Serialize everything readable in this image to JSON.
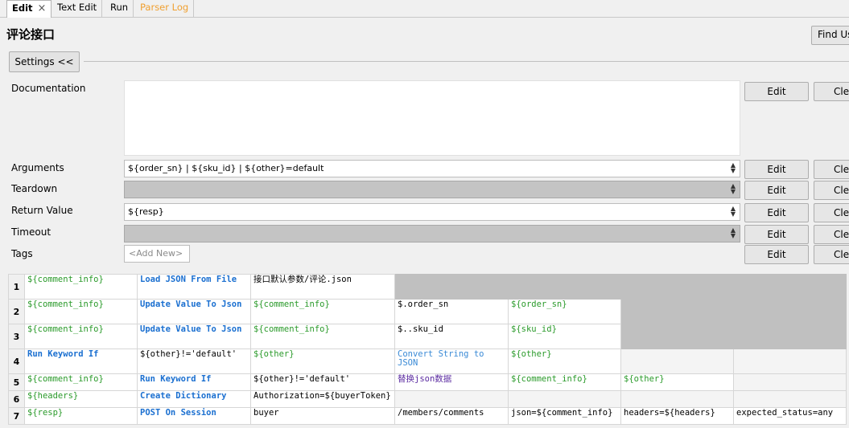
{
  "tabs": [
    {
      "label": "Edit",
      "active": true,
      "close": "×"
    },
    {
      "label": "Text Edit"
    },
    {
      "label": "Run"
    },
    {
      "label": "Parser Log",
      "color": "#f0a030"
    }
  ],
  "title": "评论接口",
  "find_usages": "Find Us",
  "settings_label": "Settings <<",
  "labels": {
    "documentation": "Documentation",
    "arguments": "Arguments",
    "teardown": "Teardown",
    "return_value": "Return Value",
    "timeout": "Timeout",
    "tags": "Tags"
  },
  "fields": {
    "documentation": "",
    "arguments": "${order_sn} | ${sku_id} | ${other}=default",
    "teardown": "",
    "return_value": "${resp}",
    "timeout": "",
    "tags_add": "<Add New>"
  },
  "buttons": {
    "edit": "Edit",
    "clear": "Cle"
  },
  "colors": {
    "variable": "#2a9a2a",
    "keyword": "#1a6fd0",
    "disabled": "#c4c4c4",
    "parser_log": "#f0a030"
  },
  "grid": {
    "rows": [
      {
        "n": "1",
        "cells": [
          "${comment_info}",
          "Load JSON From File",
          "接口默认参数/评论.json",
          "",
          "",
          "",
          ""
        ]
      },
      {
        "n": "2",
        "cells": [
          "${comment_info}",
          "Update Value To Json",
          "${comment_info}",
          "$.order_sn",
          "${order_sn}",
          "",
          ""
        ]
      },
      {
        "n": "3",
        "cells": [
          "${comment_info}",
          "Update Value To Json",
          "${comment_info}",
          "$..sku_id",
          "${sku_id}",
          "",
          ""
        ]
      },
      {
        "n": "4",
        "cells": [
          "Run Keyword If",
          "${other}!='default'",
          "${other}",
          "Convert String to JSON",
          "${other}",
          "",
          ""
        ]
      },
      {
        "n": "5",
        "cells": [
          "${comment_info}",
          "Run Keyword If",
          "${other}!='default'",
          "替换json数据",
          "${comment_info}",
          "${other}",
          ""
        ]
      },
      {
        "n": "6",
        "cells": [
          "${headers}",
          "Create Dictionary",
          "Authorization=${buyerToken}",
          "",
          "",
          "",
          ""
        ]
      },
      {
        "n": "7",
        "cells": [
          "${resp}",
          "POST On Session",
          "buyer",
          "/members/comments",
          "json=${comment_info}",
          "headers=${headers}",
          "expected_status=any"
        ]
      }
    ]
  }
}
